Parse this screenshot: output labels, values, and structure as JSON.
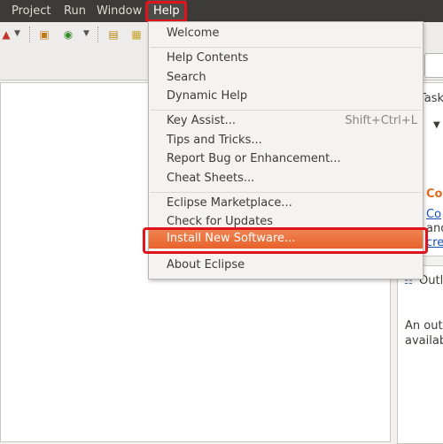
{
  "menubar": {
    "items": [
      {
        "label": "Project"
      },
      {
        "label": "Run"
      },
      {
        "label": "Window"
      },
      {
        "label": "Help"
      }
    ]
  },
  "help_menu": {
    "items": [
      {
        "label": "Welcome"
      },
      {
        "label": "Help Contents"
      },
      {
        "label": "Search"
      },
      {
        "label": "Dynamic Help"
      },
      {
        "label": "Key Assist...",
        "shortcut": "Shift+Ctrl+L"
      },
      {
        "label": "Tips and Tricks..."
      },
      {
        "label": "Report Bug or Enhancement..."
      },
      {
        "label": "Cheat Sheets..."
      },
      {
        "label": "Eclipse Marketplace..."
      },
      {
        "label": "Check for Updates"
      },
      {
        "label": "Install New Software..."
      },
      {
        "label": "About Eclipse"
      }
    ],
    "highlighted": "Install New Software..."
  },
  "right_panel": {
    "task_tab": "Task",
    "connect_title": "Co",
    "connect_link": "Co",
    "connect_text": "and",
    "connect_link2": "cre",
    "outline_tab": "Outl",
    "outline_text_1": "An outl",
    "outline_text_2": "availab"
  },
  "colors": {
    "menubar_bg": "#3c3b37",
    "highlight": "#e8622a",
    "annotation_red": "#e1141c"
  }
}
